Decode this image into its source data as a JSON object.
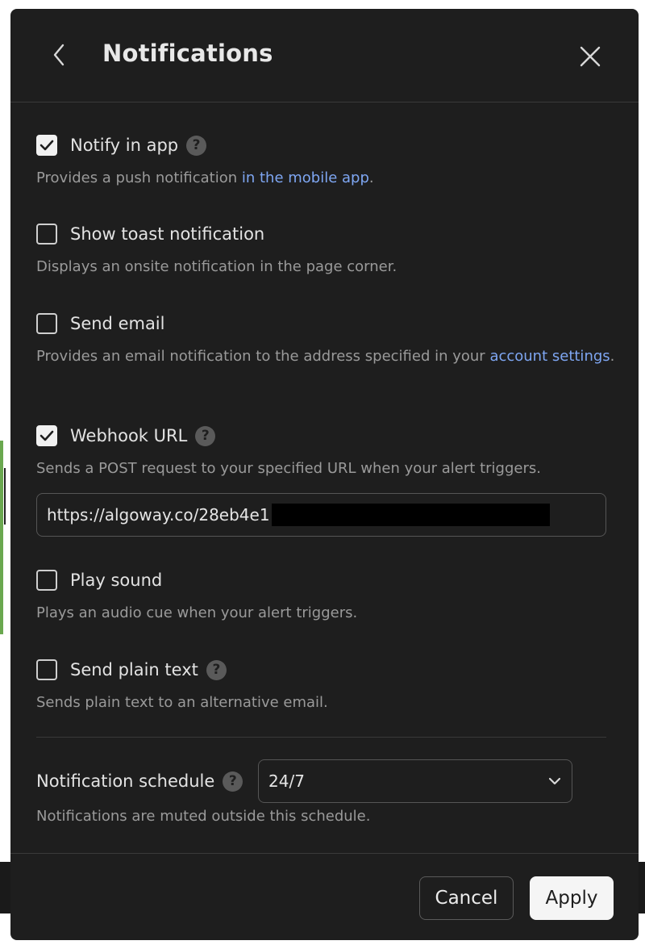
{
  "dialog": {
    "title": "Notifications",
    "back_icon": "chevron-left-icon",
    "close_icon": "close-icon"
  },
  "options": [
    {
      "label": "Notify in app",
      "checked": true,
      "has_help": true,
      "desc_before": "Provides a push notification ",
      "desc_link": "in the mobile app",
      "desc_after": "."
    },
    {
      "label": "Show toast notification",
      "checked": false,
      "has_help": false,
      "desc": "Displays an onsite notification in the page corner."
    },
    {
      "label": "Send email",
      "checked": false,
      "has_help": false,
      "desc_before": "Provides an email notification to the address specified in your ",
      "desc_link": "account settings",
      "desc_after": "."
    },
    {
      "label": "Webhook URL",
      "checked": true,
      "has_help": true,
      "desc": "Sends a POST request to your specified URL when your alert triggers."
    },
    {
      "label": "Play sound",
      "checked": false,
      "has_help": false,
      "desc": "Plays an audio cue when your alert triggers."
    },
    {
      "label": "Send plain text",
      "checked": false,
      "has_help": true,
      "desc": "Sends plain text to an alternative email."
    }
  ],
  "webhook": {
    "value": "https://algoway.co/28eb4e1"
  },
  "schedule": {
    "label": "Notification schedule",
    "selected": "24/7",
    "desc": "Notifications are muted outside this schedule."
  },
  "help_glyph": "?",
  "footer": {
    "cancel_label": "Cancel",
    "apply_label": "Apply"
  },
  "colors": {
    "dialog_bg": "#1e1e1e",
    "link": "#7ea6f2",
    "muted_text": "#9a9a9a"
  }
}
